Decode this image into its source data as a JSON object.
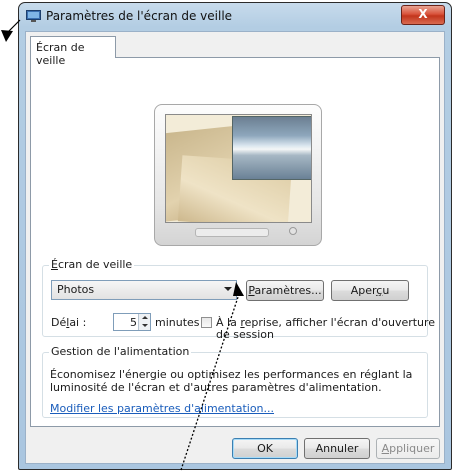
{
  "window": {
    "title": "Paramètres de l'écran de veille",
    "close_label": "X"
  },
  "tabs": [
    {
      "label": "Écran de veille"
    }
  ],
  "screensaver": {
    "group_label_first": "É",
    "group_label_rest": "cran de veille",
    "selected_option": "Photos",
    "settings_button": {
      "pre": "",
      "accel": "P",
      "post": "aramètres..."
    },
    "preview_button": {
      "pre": "Aper",
      "accel": "ç",
      "post": "u"
    },
    "delay_label": {
      "pre": "Dé",
      "accel": "l",
      "post": "ai :"
    },
    "delay_value": "5",
    "delay_unit": "minutes",
    "resume_label_line1_pre": "À la ",
    "resume_label_accel": "r",
    "resume_label_line1_post": "eprise, afficher l'écran d'ouverture",
    "resume_label_line2": "de session",
    "resume_checked": false
  },
  "power": {
    "group_label": "Gestion de l'alimentation",
    "description_line1": "Économisez l'énergie ou optimisez les performances en réglant la",
    "description_line2": "luminosité de l'écran et d'autres paramètres d'alimentation.",
    "link": "Modifier les paramètres d'alimentation..."
  },
  "footer": {
    "ok_label": "OK",
    "cancel_label": "Annuler",
    "apply_label": {
      "accel": "A",
      "post": "ppliquer"
    }
  }
}
